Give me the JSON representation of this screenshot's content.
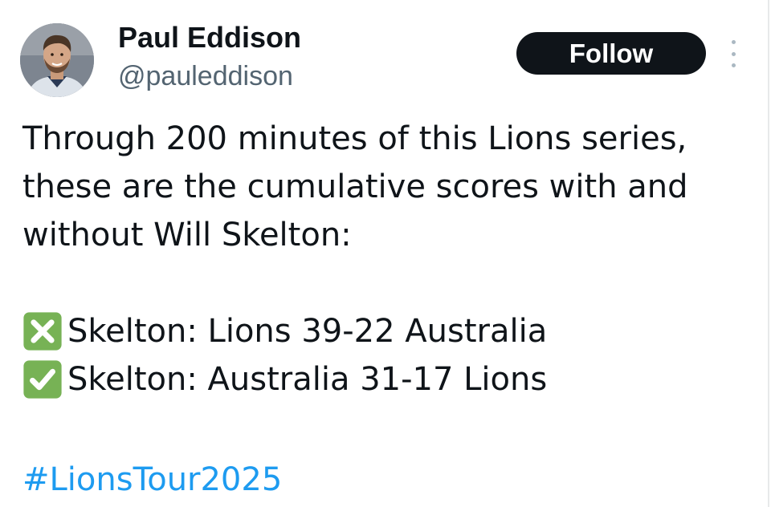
{
  "tweet": {
    "author": {
      "display_name": "Paul Eddison",
      "handle": "@pauleddison"
    },
    "follow_label": "Follow",
    "body_lines": [
      "Through 200 minutes of this Lions series,",
      "these are the cumulative scores with and",
      "without Will Skelton:"
    ],
    "stats": [
      {
        "icon": "cross-mark-icon",
        "text": "Skelton: Lions 39-22 Australia"
      },
      {
        "icon": "check-mark-icon",
        "text": "Skelton: Australia 31-17 Lions"
      }
    ],
    "hashtag": "#LionsTour2025"
  },
  "colors": {
    "text": "#0f1419",
    "secondary": "#536471",
    "link": "#1d9bf0",
    "button_bg": "#0f1419",
    "button_text": "#ffffff",
    "emoji_green": "#77b255"
  }
}
